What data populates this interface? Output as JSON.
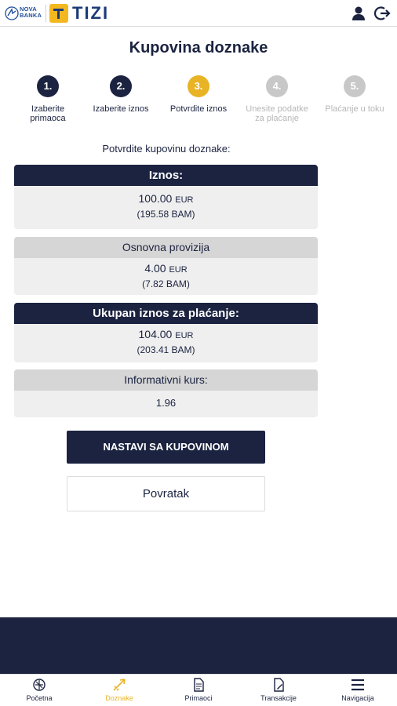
{
  "header": {
    "bank_logo_text_line1": "NOVA",
    "bank_logo_text_line2": "BANKA",
    "brand": "TIZI",
    "brand_color": "#1c3a78",
    "brand_accent": "#f4b81f",
    "icons": [
      "user-icon",
      "logout-icon"
    ]
  },
  "page": {
    "title": "Kupovina doznake",
    "confirm_prompt": "Potvrdite kupovinu doznake:"
  },
  "steps": [
    {
      "number": "1.",
      "label_line1": "Izaberite",
      "label_line2": "primaoca",
      "state": "done"
    },
    {
      "number": "2.",
      "label_line1": "Izaberite iznos",
      "label_line2": "",
      "state": "done"
    },
    {
      "number": "3.",
      "label_line1": "Potvrdite iznos",
      "label_line2": "",
      "state": "active"
    },
    {
      "number": "4.",
      "label_line1": "Unesite podatke",
      "label_line2": "za plaćanje",
      "state": "todo"
    },
    {
      "number": "5.",
      "label_line1": "Plaćanje u toku",
      "label_line2": "",
      "state": "todo"
    }
  ],
  "cards": {
    "amount": {
      "title": "Iznos:",
      "value": "100.00",
      "currency": "EUR",
      "converted": "(195.58 BAM)"
    },
    "fee": {
      "title": "Osnovna provizija",
      "value": "4.00",
      "currency": "EUR",
      "converted": "(7.82 BAM)"
    },
    "total": {
      "title": "Ukupan iznos za plaćanje:",
      "value": "104.00",
      "currency": "EUR",
      "converted": "(203.41 BAM)"
    },
    "rate": {
      "title": "Informativni kurs:",
      "value": "1.96"
    }
  },
  "buttons": {
    "continue": "NASTAVI SA KUPOVINOM",
    "back": "Povratak"
  },
  "bottom_nav": [
    {
      "label": "Početna",
      "icon": "home-icon",
      "active": false
    },
    {
      "label": "Doznake",
      "icon": "plane-icon",
      "active": true
    },
    {
      "label": "Primaoci",
      "icon": "document-icon",
      "active": false
    },
    {
      "label": "Transakcije",
      "icon": "edit-document-icon",
      "active": false
    },
    {
      "label": "Navigacija",
      "icon": "menu-icon",
      "active": false
    }
  ],
  "colors": {
    "navy": "#1b2340",
    "active_step": "#e8b325",
    "inactive_step": "#c8c8c8"
  }
}
